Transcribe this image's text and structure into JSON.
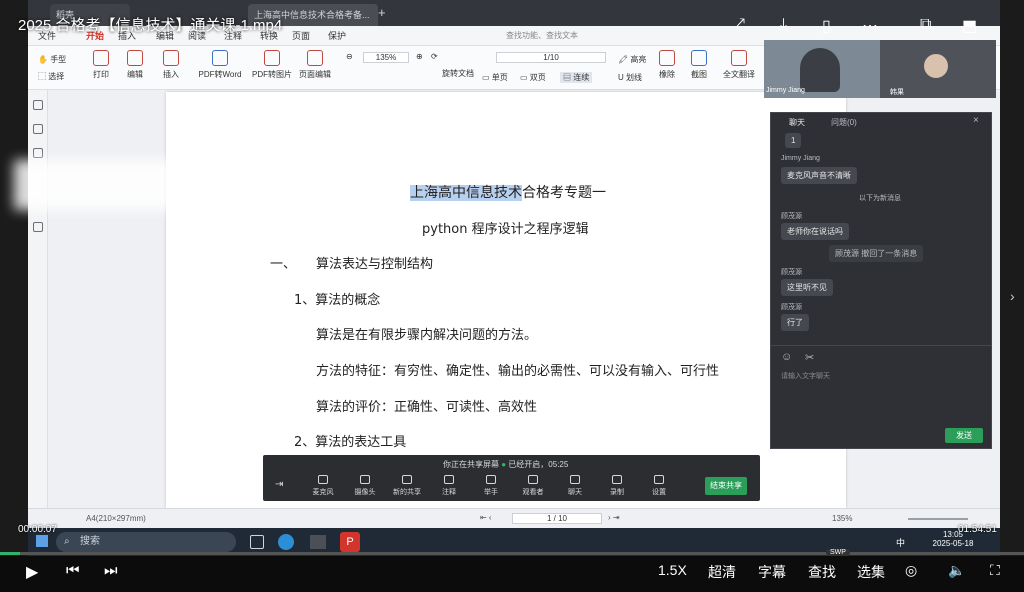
{
  "video": {
    "title": "2025 合格考【信息技术】通关课-1.mp4",
    "time_current": "00:00:07",
    "time_total": "01:54:51",
    "progress": 0.001,
    "speed": "1.5X",
    "quality": "超清",
    "subtitles": "字幕",
    "search": "查找",
    "episodes": "选集",
    "swp_badge": "SWP"
  },
  "pdf_app": {
    "home_tab": "稻壳",
    "doc_tab": "上海高中信息技术合格考备...",
    "menus": [
      "文件",
      "开始",
      "插入",
      "编辑",
      "阅读",
      "注释",
      "转换",
      "页面",
      "保护"
    ],
    "active_menu": "开始",
    "search_placeholder": "查找功能、查找文本",
    "tools_left": [
      {
        "label": "手型"
      },
      {
        "label": "选择"
      }
    ],
    "tools": [
      "打印",
      "编辑",
      "插入",
      "PDF转Word",
      "PDF转图片",
      "页面编辑"
    ],
    "zoom": "135%",
    "page_indicator": "1/10",
    "rotate_label": "旋转文档",
    "view_single": "单页",
    "view_double": "双页",
    "view_continuous": "连续",
    "highlight": "高亮",
    "underline": "划线",
    "eraser": "橡除",
    "screenshot": "截图",
    "translate": "全文翻译",
    "page_size": "A4(210×297mm)",
    "status_page": "1 / 10",
    "status_zoom": "135%"
  },
  "document": {
    "title_hl": "上海高中信息技术",
    "title_rest": "合格考专题一",
    "subtitle": "python 程序设计之程序逻辑",
    "section1_num": "一、",
    "section1": "算法表达与控制结构",
    "item1": "1、算法的概念",
    "line1": "算法是在有限步骤内解决问题的方法。",
    "line2": "方法的特征：有穷性、确定性、输出的必需性、可以没有输入、可行性",
    "line3": "算法的评价：正确性、可读性、高效性",
    "item2": "2、算法的表达工具"
  },
  "share_bar": {
    "status": "你正在共享屏幕",
    "recording": "已经开启，05:25",
    "buttons": [
      "麦克风",
      "摄像头",
      "新的共享",
      "注释",
      "举手",
      "观看者",
      "聊天",
      "录制",
      "设置"
    ],
    "end_button": "结束共享"
  },
  "chat": {
    "tab_chat": "聊天",
    "tab_questions": "问题(0)",
    "messages": [
      {
        "name": "",
        "text": "1"
      },
      {
        "name": "Jimmy Jiang",
        "text": "麦克风声音不清晰"
      }
    ],
    "new_divider": "以下为新消息",
    "messages2": [
      {
        "name": "顾茂源",
        "text": "老师你在说话吗"
      }
    ],
    "recall_notice": "顾茂源 撤回了一条消息",
    "messages3": [
      {
        "name": "顾茂源",
        "text": "这里听不见"
      },
      {
        "name": "顾茂源",
        "text": "行了"
      }
    ],
    "input_placeholder": "请输入文字聊天",
    "send_button": "发送"
  },
  "cams": {
    "cam1_name": "Jimmy Jiang",
    "cam2_name": "韩果"
  },
  "taskbar": {
    "search": "搜索",
    "time": "13:05",
    "date": "2025-05-18",
    "ime": "中"
  },
  "colors": {
    "pdf_red": "#d1352b",
    "highlight": "#b8d0ef",
    "send_green": "#2b9e5a",
    "progress_green": "#2fb36c"
  }
}
